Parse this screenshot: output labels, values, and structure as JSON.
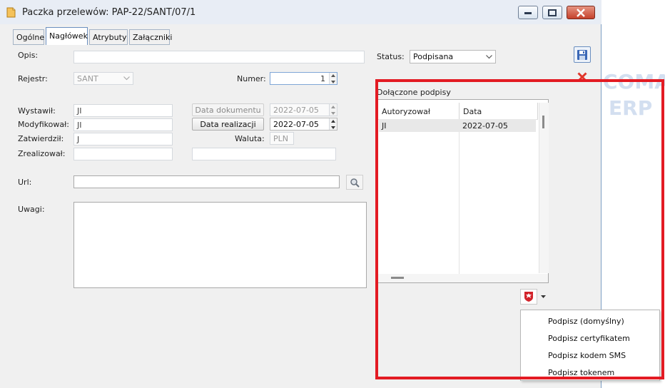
{
  "window": {
    "title": "Paczka przelewów: PAP-22/SANT/07/1"
  },
  "tabs": [
    {
      "label": "Ogólne"
    },
    {
      "label": "Nagłówek"
    },
    {
      "label": "Atrybuty"
    },
    {
      "label": "Załączniki"
    }
  ],
  "form": {
    "opis": {
      "label": "Opis:",
      "value": ""
    },
    "status": {
      "label": "Status:",
      "value": "Podpisana"
    },
    "rejestr": {
      "label": "Rejestr:",
      "value": "SANT"
    },
    "numer": {
      "label": "Numer:",
      "value": "1"
    },
    "wystawil": {
      "label": "Wystawił:",
      "value": "JI"
    },
    "modyfikowal": {
      "label": "Modyfikował:",
      "value": "JI"
    },
    "zatwierdzil": {
      "label": "Zatwierdził:",
      "value": "J"
    },
    "zrealizowal": {
      "label": "Zrealizował:",
      "value": ""
    },
    "data_dokumentu": {
      "button": "Data dokumentu",
      "value": "2022-07-05"
    },
    "data_realizacji": {
      "button": "Data realizacji",
      "value": "2022-07-05"
    },
    "waluta": {
      "label": "Waluta:",
      "value": "PLN"
    },
    "url": {
      "label": "Url:",
      "value": ""
    },
    "uwagi": {
      "label": "Uwagi:",
      "value": ""
    }
  },
  "signatures": {
    "title": "Dołączone podpisy",
    "columns": [
      "Autoryzował",
      "Data"
    ],
    "rows": [
      {
        "autoryzowal": "JI",
        "data": "2022-07-05"
      }
    ]
  },
  "context_menu": {
    "items": [
      {
        "label": "Podpisz (domyślny)"
      },
      {
        "label": "Podpisz certyfikatem"
      },
      {
        "label": "Podpisz kodem SMS"
      },
      {
        "label": "Podpisz tokenem"
      }
    ]
  },
  "background_watermark": {
    "line1": "COMA",
    "line2": "ERP"
  },
  "icons": {
    "app": "document-package-icon",
    "save": "floppy-disk-icon",
    "cancel": "red-x-icon",
    "search": "magnifier-icon",
    "sign": "eagle-emblem-icon"
  },
  "colors": {
    "accent": "#e31b23",
    "title_bar": "#e8edf5",
    "window_bg": "#f0f0f0"
  }
}
